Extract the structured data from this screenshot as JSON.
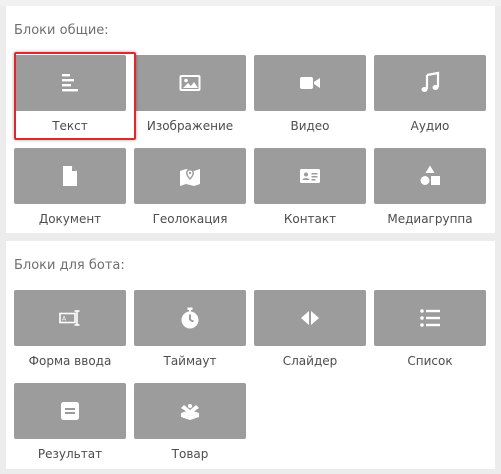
{
  "general_blocks": {
    "title": "Блоки общие:",
    "items": [
      {
        "label": "Текст",
        "icon": "text-align-left-icon",
        "selected": true
      },
      {
        "label": "Изображение",
        "icon": "image-icon"
      },
      {
        "label": "Видео",
        "icon": "video-camera-icon"
      },
      {
        "label": "Аудио",
        "icon": "music-note-icon"
      },
      {
        "label": "Документ",
        "icon": "document-icon"
      },
      {
        "label": "Геолокация",
        "icon": "map-pin-icon"
      },
      {
        "label": "Контакт",
        "icon": "contact-card-icon"
      },
      {
        "label": "Медиагруппа",
        "icon": "shapes-icon"
      }
    ]
  },
  "bot_blocks": {
    "title": "Блоки для бота:",
    "items": [
      {
        "label": "Форма ввода",
        "icon": "input-field-icon"
      },
      {
        "label": "Таймаут",
        "icon": "stopwatch-icon"
      },
      {
        "label": "Слайдер",
        "icon": "slider-arrows-icon"
      },
      {
        "label": "Список",
        "icon": "list-icon"
      },
      {
        "label": "Результат",
        "icon": "result-icon"
      },
      {
        "label": "Товар",
        "icon": "product-box-icon"
      }
    ]
  },
  "colors": {
    "tile": "#9c9c9c",
    "selection": "#e3262b",
    "label": "#4d4d4d",
    "title": "#6f6f6f",
    "background": "#ececec"
  }
}
